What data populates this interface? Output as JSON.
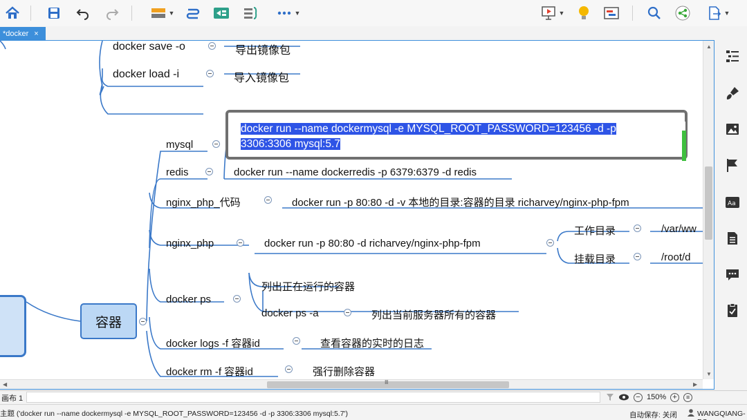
{
  "tab": {
    "title": "*docker",
    "close": "×"
  },
  "map": {
    "central": "容器",
    "top_rows": [
      {
        "command": "docker save -o",
        "desc": "导出镜像包"
      },
      {
        "command": "docker load  -i",
        "desc": "导入镜像包"
      }
    ],
    "branches": {
      "mysql": "mysql",
      "mysql_cmd_line1": "docker run --name dockermysql -e MYSQL_ROOT_PASSWORD=123456 -d -p",
      "mysql_cmd_line2": "3306:3306 mysql:5.7",
      "redis": "redis",
      "redis_cmd": "docker run --name dockerredis -p 6379:6379 -d redis",
      "nginx_code": "nginx_php_代码",
      "nginx_code_cmd": "docker run -p 80:80 -d -v 本地的目录:容器的目录 richarvey/nginx-php-fpm",
      "nginx": "nginx_php",
      "nginx_cmd": "docker run -p 80:80 -d richarvey/nginx-php-fpm",
      "workdir": "工作目录",
      "workdir_value": "/var/ww",
      "mountdir": "挂载目录",
      "mountdir_value": "/root/d",
      "ps": "docker ps",
      "ps_desc": "列出正在运行的容器",
      "ps_a": "docker ps -a",
      "ps_a_desc": "列出当前服务器所有的容器",
      "logs": "docker logs -f 容器id",
      "logs_desc": "查看容器的实时的日志",
      "rm": "docker rm -f 容器id",
      "rm_desc": "强行删除容器"
    }
  },
  "sheet": {
    "tab": "画布 1",
    "zoom": "150%"
  },
  "status": {
    "text": "主题 ('docker run --name dockermysql -e MYSQL_ROOT_PASSWORD=123456 -d -p 3306:3306 mysql:5.7')",
    "autosave": "自动保存: 关闭",
    "user": "WANGQIANG-PC"
  },
  "icons": {
    "toolbar": [
      "home-icon",
      "save-icon",
      "undo-icon",
      "redo-icon",
      "insert-topic-icon",
      "relationship-icon",
      "boundary-icon",
      "summary-icon",
      "more-icon",
      "presentation-icon",
      "brainstorm-icon",
      "gantt-icon",
      "search-icon",
      "share-icon",
      "export-icon"
    ],
    "sidebar": [
      "outline-icon",
      "format-icon",
      "image-icon",
      "marker-icon",
      "font-icon",
      "notes-icon",
      "comments-icon",
      "task-icon"
    ]
  },
  "colors": {
    "accent": "#3d8fdb",
    "selection": "#2e54e6",
    "node_fill": "#bcd8f5",
    "node_border": "#3a78c8",
    "branch": "#3a78c8"
  }
}
